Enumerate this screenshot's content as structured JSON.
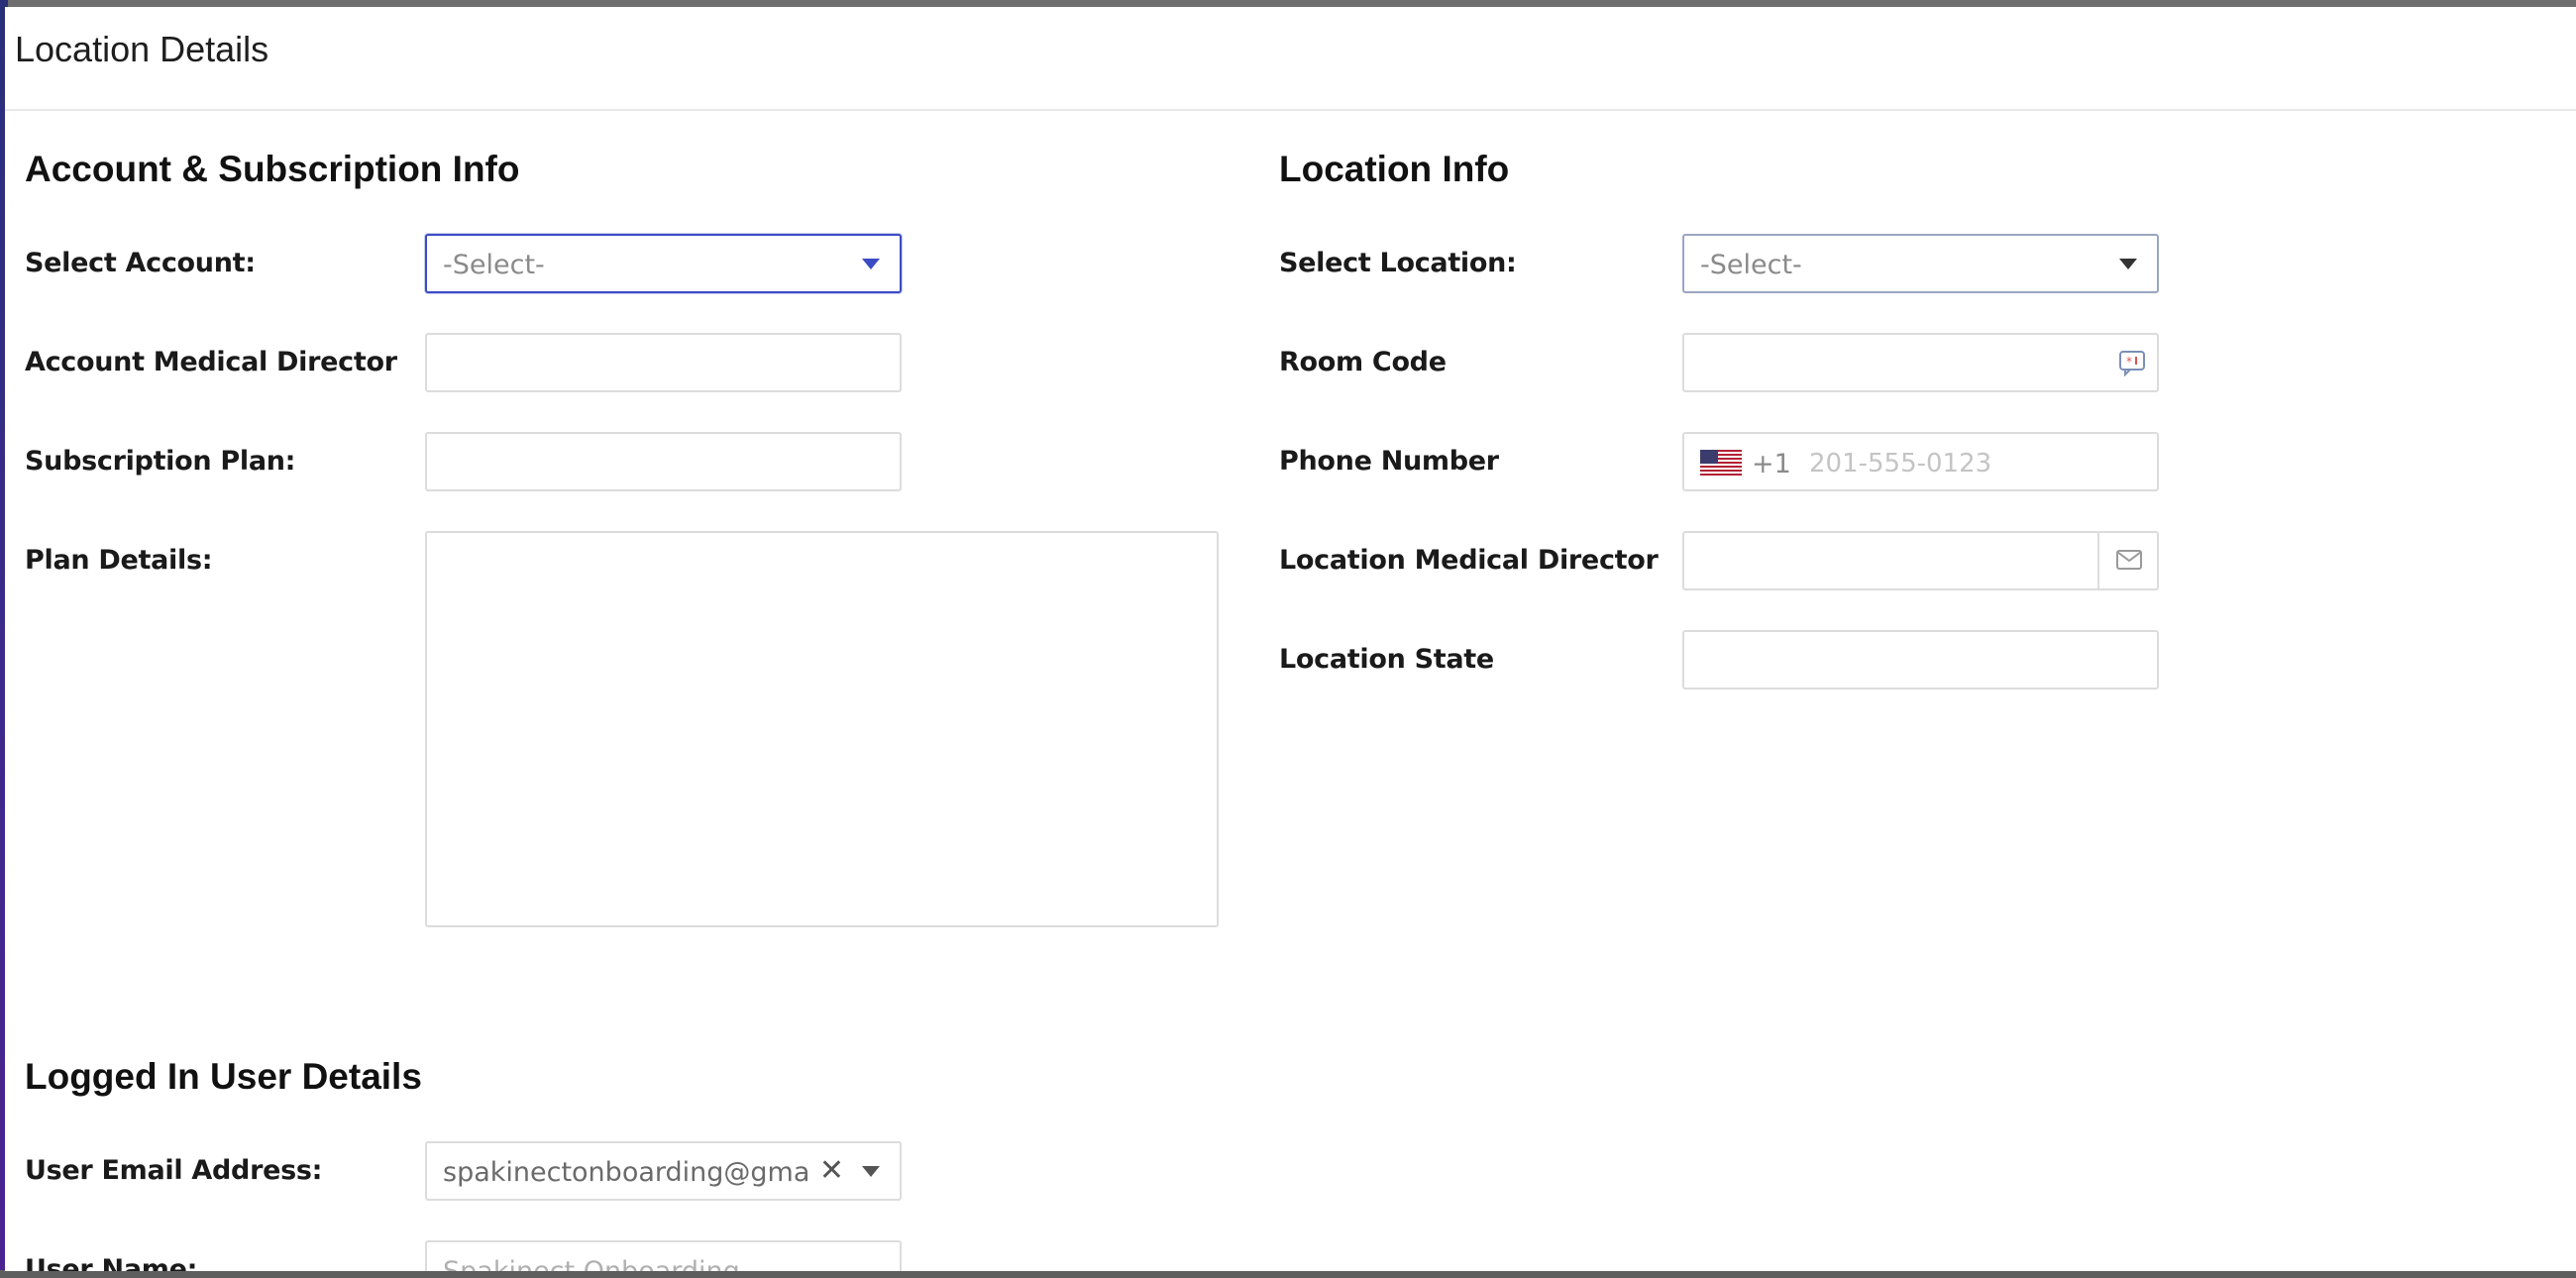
{
  "modal": {
    "title": "Location Details"
  },
  "account_section": {
    "title": "Account & Subscription Info",
    "select_account": {
      "label": "Select Account:",
      "value": "-Select-"
    },
    "account_medical_director": {
      "label": "Account Medical Director",
      "value": ""
    },
    "subscription_plan": {
      "label": "Subscription Plan:",
      "value": ""
    },
    "plan_details": {
      "label": "Plan Details:",
      "value": ""
    }
  },
  "location_section": {
    "title": "Location Info",
    "select_location": {
      "label": "Select Location:",
      "value": "-Select-"
    },
    "room_code": {
      "label": "Room Code",
      "value": ""
    },
    "phone_number": {
      "label": "Phone Number",
      "country_code": "+1",
      "placeholder": "201-555-0123",
      "flag": "us-flag-icon"
    },
    "location_medical_director": {
      "label": "Location Medical Director",
      "value": "",
      "addon_icon": "envelope-icon"
    },
    "location_state": {
      "label": "Location State",
      "value": ""
    }
  },
  "user_section": {
    "title": "Logged In User Details",
    "user_email": {
      "label": "User Email Address:",
      "value": "spakinectonboarding@gmail...."
    },
    "user_name": {
      "label": "User Name:",
      "value": "Spakinect Onboarding"
    }
  },
  "colors": {
    "focus_border": "#3b4bc4",
    "field_border": "#dcdcdc",
    "placeholder": "#8a8a8a"
  }
}
